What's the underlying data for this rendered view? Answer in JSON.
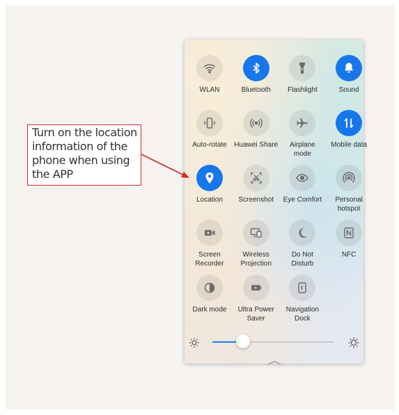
{
  "annotation": {
    "lines": [
      "Turn on the location",
      "information of the",
      "phone when using",
      "the APP"
    ],
    "color": "#d9252a"
  },
  "panel": {
    "accent": "#1777ea",
    "tiles": [
      {
        "label": "WLAN",
        "icon": "wifi-icon",
        "active": false
      },
      {
        "label": "Bluetooth",
        "icon": "bluetooth-icon",
        "active": true
      },
      {
        "label": "Flashlight",
        "icon": "flashlight-icon",
        "active": false
      },
      {
        "label": "Sound",
        "icon": "bell-icon",
        "active": true
      },
      {
        "label": "Auto-rotate",
        "icon": "auto-rotate-icon",
        "active": false
      },
      {
        "label": "Huawei Share",
        "icon": "huawei-share-icon",
        "active": false
      },
      {
        "label": "Airplane\nmode",
        "icon": "airplane-icon",
        "active": false
      },
      {
        "label": "Mobile data",
        "icon": "mobile-data-icon",
        "active": true
      },
      {
        "label": "Location",
        "icon": "location-pin-icon",
        "active": true
      },
      {
        "label": "Screenshot",
        "icon": "screenshot-icon",
        "active": false
      },
      {
        "label": "Eye Comfort",
        "icon": "eye-icon",
        "active": false
      },
      {
        "label": "Personal\nhotspot",
        "icon": "hotspot-icon",
        "active": false
      },
      {
        "label": "Screen\nRecorder",
        "icon": "video-camera-icon",
        "active": false
      },
      {
        "label": "Wireless\nProjection",
        "icon": "wireless-projection-icon",
        "active": false
      },
      {
        "label": "Do Not\nDisturb",
        "icon": "moon-icon",
        "active": false
      },
      {
        "label": "NFC",
        "icon": "nfc-icon",
        "active": false
      },
      {
        "label": "Dark mode",
        "icon": "dark-mode-icon",
        "active": false
      },
      {
        "label": "Ultra Power\nSaver",
        "icon": "battery-bolt-icon",
        "active": false
      },
      {
        "label": "Navigation\nDock",
        "icon": "navigation-dock-icon",
        "active": false
      }
    ],
    "brightness": {
      "level": 0.25,
      "low_icon": "brightness-low-icon",
      "high_icon": "brightness-high-icon"
    },
    "collapse_icon": "chevron-up-icon"
  }
}
